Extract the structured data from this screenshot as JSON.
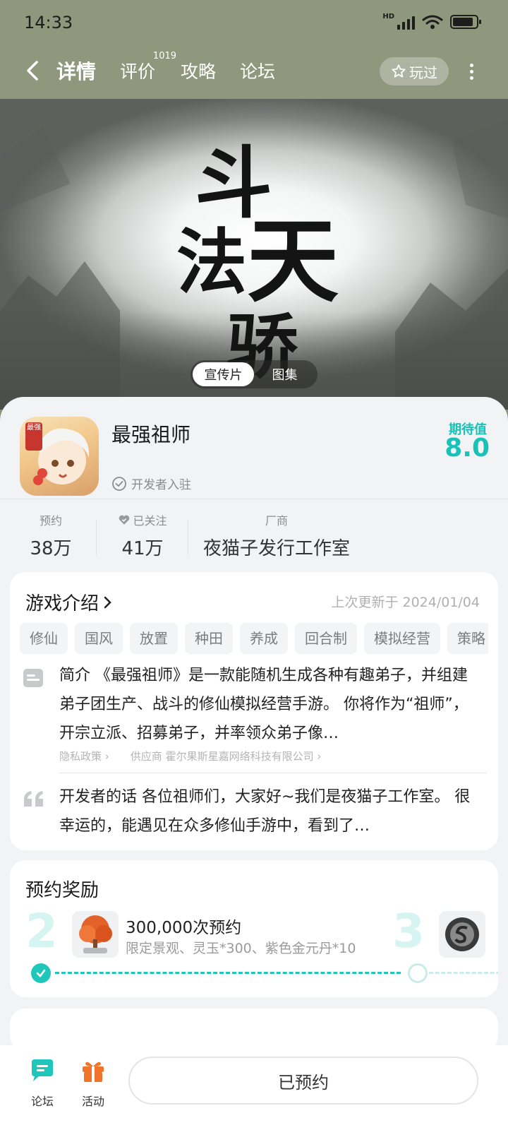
{
  "status_bar": {
    "time": "14:33",
    "network": "HD"
  },
  "nav": {
    "tabs": [
      {
        "label": "详情"
      },
      {
        "label": "评价",
        "badge": "1019"
      },
      {
        "label": "攻略"
      },
      {
        "label": "论坛"
      }
    ],
    "played_label": "玩过"
  },
  "banner": {
    "calligraphy": [
      "斗",
      "法",
      "天",
      "骄"
    ],
    "media_options": [
      "宣传片",
      "图集"
    ]
  },
  "game": {
    "name": "最强祖师",
    "icon_text": "最强",
    "dev_tag": "开发者入驻",
    "expect_label": "期待值",
    "expect_score": "8.0"
  },
  "stats": {
    "reserve": {
      "label": "预约",
      "value": "38万"
    },
    "follow": {
      "label": "已关注",
      "value": "41万"
    },
    "vendor": {
      "label": "厂商",
      "value": "夜猫子发行工作室"
    }
  },
  "intro": {
    "title": "游戏介绍",
    "updated": "上次更新于 2024/01/04",
    "tags": [
      "修仙",
      "国风",
      "放置",
      "种田",
      "养成",
      "回合制",
      "模拟经营",
      "策略"
    ],
    "summary": "简介 《最强祖师》是一款能随机生成各种有趣弟子，并组建弟子团生产、战斗的修仙模拟经营手游。 你将作为“祖师”，开宗立派、招募弟子，并率领众弟子像…",
    "privacy": "隐私政策",
    "supplier": "供应商 霍尔果斯星嘉网络科技有限公司",
    "dev_words": "开发者的话 各位祖师们，大家好~我们是夜猫子工作室。 很幸运的，能遇见在众多修仙手游中，看到了…"
  },
  "rewards": {
    "title": "预约奖励",
    "milestone_num": "2",
    "milestone_name": "300,000次预约",
    "milestone_desc": "限定景观、灵玉*300、紫色金元丹*10",
    "next_num": "3"
  },
  "bottom": {
    "forum": "论坛",
    "activity": "活动",
    "reserved": "已预约"
  },
  "colors": {
    "accent": "#18c2b8",
    "header_bg": "#8f977d"
  }
}
